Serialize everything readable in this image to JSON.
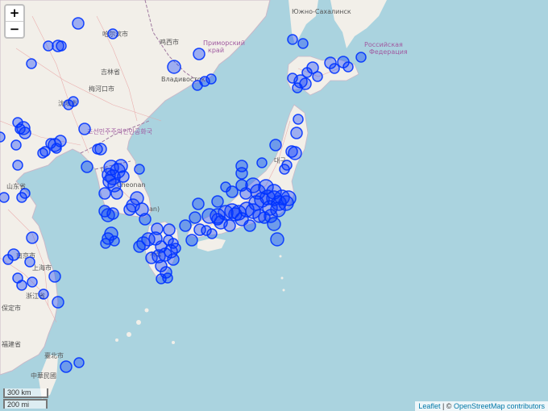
{
  "zoom": {
    "in_label": "+",
    "out_label": "−"
  },
  "scale": {
    "km_label": "300 km",
    "mi_label": "200 mi"
  },
  "attribution": {
    "leaflet": "Leaflet",
    "separator": " | © ",
    "osm": "OpenStreetMap contributors"
  },
  "places": {
    "harbin": "哈尔滨市",
    "jixi": "鸡西市",
    "primorsky": "Приморский",
    "krai": "край",
    "jilin": "吉林省",
    "meihekou": "梅河口市",
    "vladivostok": "Владивосток",
    "yuzhno": "Южно-Сахалинск",
    "russia1": "Российская",
    "russia2": "Федерация",
    "shenyang": "沈阳市",
    "dprk": "조선민주주의인민공화국",
    "shandong": "山东省",
    "shanghai": "上海市",
    "zhejiang": "浙江省",
    "fujian": "福建省",
    "taipei": "臺北市",
    "roc": "中華民國",
    "hoten": "保定市",
    "nanjing": "南京市",
    "daegu": "대구",
    "seoul": "서울",
    "cheonan": "Cheonan",
    "n_label": "(n",
    "an_label": "an)"
  },
  "marker_color": "#0033ff",
  "markers": {
    "dense_points": [
      [
        -73,
        "C",
        133,
        "H"
      ],
      [
        -80,
        "R",
        138,
        "Q",
        166,
        "Q"
      ]
    ]
  }
}
